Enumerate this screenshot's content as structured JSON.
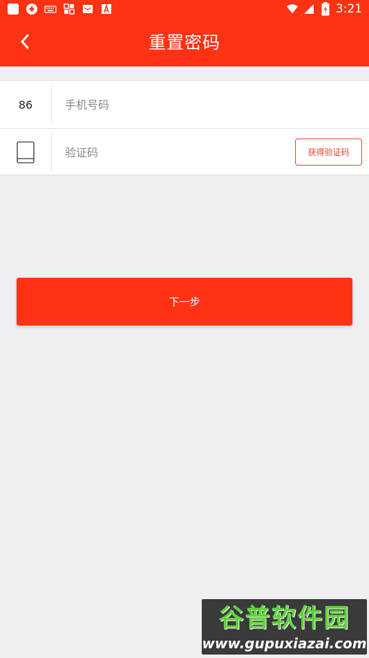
{
  "status_bar": {
    "left_icons": [
      "square-icon",
      "shield-app-icon",
      "keyboard-icon",
      "apps-icon",
      "mail-icon",
      "font-a-icon"
    ],
    "right_icons": [
      "wifi-icon",
      "signal-icon",
      "battery-charging-icon"
    ],
    "time": "3:21"
  },
  "header": {
    "back_icon": "chevron-left-icon",
    "title": "重置密码"
  },
  "form": {
    "phone": {
      "country_code": "86",
      "placeholder": "手机号码",
      "value": ""
    },
    "code": {
      "icon": "tablet-icon",
      "placeholder": "验证码",
      "value": "",
      "get_code_label": "获得验证码"
    }
  },
  "next_button": {
    "label": "下一步"
  },
  "watermark": {
    "title": "谷普软件园",
    "url": "www.gupuxiazai.com"
  },
  "colors": {
    "accent": "#ff3314",
    "background": "#eeeef3",
    "outline_red": "#e8402a"
  }
}
